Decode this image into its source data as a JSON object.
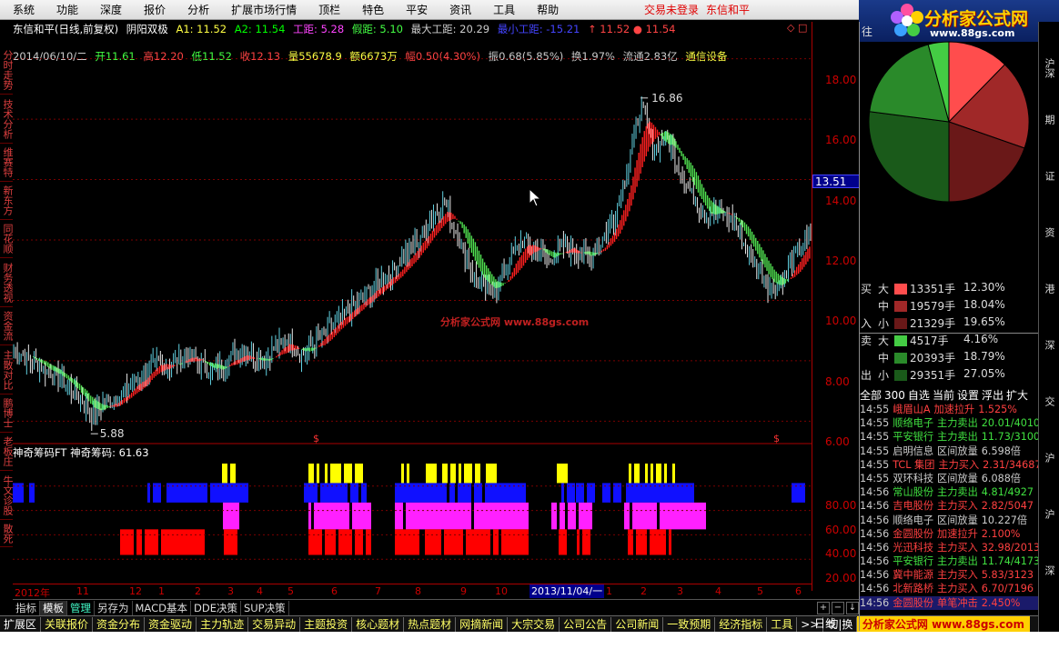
{
  "menu": [
    "系统",
    "功能",
    "深度",
    "报价",
    "分析",
    "扩展市场行情",
    "顶栏",
    "特色",
    "平安",
    "资讯",
    "工具",
    "帮助"
  ],
  "notice": "交易未登录",
  "notice_stock": "东信和平",
  "logo": {
    "title": "分析家公式网",
    "url": "www.88gs.com"
  },
  "left_tabs": [
    "分时走势",
    "技术分析",
    "维赛特",
    "新东方",
    "同花顺",
    "财务透视",
    "资金流",
    "主散对比",
    "鹏博士",
    "老板庄",
    "牛文诊股",
    "散死"
  ],
  "header": {
    "stock": "东信和平(日线,前复权)",
    "indicator": "阴阳双极",
    "a1": "A1: 11.52",
    "a2": "A2: 11.54",
    "gongju": "工距: 5.28",
    "jiaju": "假距: 5.10",
    "maxju": "最大工距: 20.29",
    "minju": "最小工距: -15.21",
    "marks": "↑ 11.52  ● 11.54"
  },
  "quote": {
    "date": "2014/06/10/二",
    "open": "开11.61",
    "high": "高12.20",
    "low": "低11.52",
    "close": "收12.13",
    "vol": "量55678.9",
    "amt": "额6673万",
    "chg": "幅0.50(4.30%)",
    "amp": "振0.68(5.85%)",
    "turn": "换1.97%",
    "float": "流通2.83亿",
    "sector": "通信设备"
  },
  "watermark": "分析家公式网 www.88gs.com",
  "chart_data": {
    "type": "line",
    "title": "东信和平(日线,前复权)",
    "ylim": [
      5.5,
      18.5
    ],
    "yticks": [
      "18.00",
      "16.00",
      "14.00",
      "12.00",
      "10.00",
      "8.00",
      "6.00"
    ],
    "current_price": "13.51",
    "high_label": "16.86",
    "low_label": "5.88",
    "series": [
      {
        "name": "close",
        "values": [
          8.4,
          8.1,
          7.8,
          7.6,
          7.2,
          6.8,
          6.2,
          6.6,
          6.8,
          7.2,
          7.6,
          7.9,
          7.8,
          8.2,
          8.0,
          7.6,
          7.9,
          8.3,
          8.2,
          8.0,
          8.4,
          8.7,
          8.2,
          8.6,
          9.0,
          9.4,
          9.8,
          10.2,
          10.6,
          11.0,
          11.5,
          12.0,
          12.8,
          13.2,
          12.1,
          11.0,
          10.3,
          10.4,
          11.4,
          12.0,
          11.6,
          11.3,
          11.8,
          11.6,
          11.4,
          12.0,
          12.8,
          14.5,
          16.5,
          15.0,
          15.4,
          14.3,
          13.4,
          12.8,
          13.0,
          12.6,
          11.8,
          11.0,
          10.4,
          10.8,
          11.6,
          12.13
        ]
      }
    ],
    "sub_indicator": {
      "name": "神奇筹码FT",
      "label": "神奇筹码: 61.63",
      "yticks": [
        "80.00",
        "60.00",
        "40.00",
        "20.00"
      ]
    },
    "x_ticks": [
      "2012年",
      "11",
      "12",
      "1",
      "2",
      "3",
      "4",
      "5",
      "6",
      "7",
      "8",
      "9",
      "10",
      "11",
      "12",
      "1",
      "2",
      "3",
      "4",
      "5",
      "6"
    ],
    "x_cursor_label": "2013/11/04/一",
    "period": "日线"
  },
  "bottom_tabs": [
    "指标",
    "模板",
    "管理",
    "另存为",
    "MACD基本",
    "DDE决策",
    "SUP决策"
  ],
  "footer": [
    "扩展区",
    "关联报价",
    "资金分布",
    "资金驱动",
    "主力轨迹",
    "交易异动",
    "主题投资",
    "核心题材",
    "热点题材",
    "网摘新闻",
    "大宗交易",
    "公司公告",
    "公司新闻",
    "一致预期",
    "经济指标",
    "工具",
    ">>",
    "切|换",
    "主"
  ],
  "footer_logo": "分析家公式网 www.88gs.com",
  "right_panel": {
    "top_label": "往",
    "pie": [
      {
        "label": "买大",
        "pct": 12.3,
        "color": "#ff4d4d"
      },
      {
        "label": "买中",
        "pct": 18.04,
        "color": "#a02828"
      },
      {
        "label": "买小",
        "pct": 19.65,
        "color": "#6a1818"
      },
      {
        "label": "卖大",
        "pct": 4.16,
        "color": "#44cc44"
      },
      {
        "label": "卖中",
        "pct": 18.79,
        "color": "#2a8a2a"
      },
      {
        "label": "卖小",
        "pct": 27.05,
        "color": "#1a5a1a"
      }
    ],
    "flows": [
      {
        "cat": "买",
        "sz": "大",
        "vol": "13351手",
        "pct": "12.30%",
        "color": "#ff4d4d"
      },
      {
        "cat": "",
        "sz": "中",
        "vol": "19579手",
        "pct": "18.04%",
        "color": "#a02828"
      },
      {
        "cat": "入",
        "sz": "小",
        "vol": "21329手",
        "pct": "19.65%",
        "color": "#6a1818"
      },
      {
        "cat": "卖",
        "sz": "大",
        "vol": "4517手",
        "pct": "4.16%",
        "color": "#44cc44"
      },
      {
        "cat": "",
        "sz": "中",
        "vol": "20393手",
        "pct": "18.79%",
        "color": "#2a8a2a"
      },
      {
        "cat": "出",
        "sz": "小",
        "vol": "29351手",
        "pct": "27.05%",
        "color": "#1a5a1a"
      }
    ],
    "actions": [
      "全部",
      "300",
      "自选",
      "当前",
      "设置",
      "浮出",
      "扩大"
    ],
    "trades": [
      {
        "t": "14:55",
        "n": "峨眉山A",
        "a": "加速拉升",
        "v": "1.525%",
        "c": "#ff4040"
      },
      {
        "t": "14:55",
        "n": "顺络电子",
        "a": "主力卖出",
        "v": "20.01/4010",
        "c": "#40e040"
      },
      {
        "t": "14:55",
        "n": "平安银行",
        "a": "主力卖出",
        "v": "11.73/3100",
        "c": "#40e040"
      },
      {
        "t": "14:55",
        "n": "启明信息",
        "a": "区间放量",
        "v": "6.598倍",
        "c": "#cccccc"
      },
      {
        "t": "14:55",
        "n": "TCL 集团",
        "a": "主力买入",
        "v": "2.31/34687",
        "c": "#ff4040"
      },
      {
        "t": "14:55",
        "n": "双环科技",
        "a": "区间放量",
        "v": "6.088倍",
        "c": "#cccccc"
      },
      {
        "t": "14:56",
        "n": "常山股份",
        "a": "主力卖出",
        "v": "4.81/4927",
        "c": "#40e040"
      },
      {
        "t": "14:56",
        "n": "吉电股份",
        "a": "主力买入",
        "v": "2.82/5047",
        "c": "#ff4040"
      },
      {
        "t": "14:56",
        "n": "顺络电子",
        "a": "区间放量",
        "v": "10.227倍",
        "c": "#cccccc"
      },
      {
        "t": "14:56",
        "n": "金圆股份",
        "a": "加速拉升",
        "v": "2.100%",
        "c": "#ff4040"
      },
      {
        "t": "14:56",
        "n": "光迅科技",
        "a": "主力买入",
        "v": "32.98/2013",
        "c": "#ff4040"
      },
      {
        "t": "14:56",
        "n": "平安银行",
        "a": "主力卖出",
        "v": "11.74/4173",
        "c": "#40e040"
      },
      {
        "t": "14:56",
        "n": "冀中能源",
        "a": "主力买入",
        "v": "5.83/3123",
        "c": "#ff4040"
      },
      {
        "t": "14:56",
        "n": "北新路桥",
        "a": "主力买入",
        "v": "6.70/7196",
        "c": "#ff4040"
      },
      {
        "t": "14:56",
        "n": "金圆股份",
        "a": "单笔冲击",
        "v": "2.450%",
        "c": "#ff4040"
      }
    ]
  },
  "right_tabs": [
    "沪深",
    "期",
    "证",
    "资",
    "港",
    "深",
    "交",
    "沪",
    "沪",
    "深"
  ]
}
